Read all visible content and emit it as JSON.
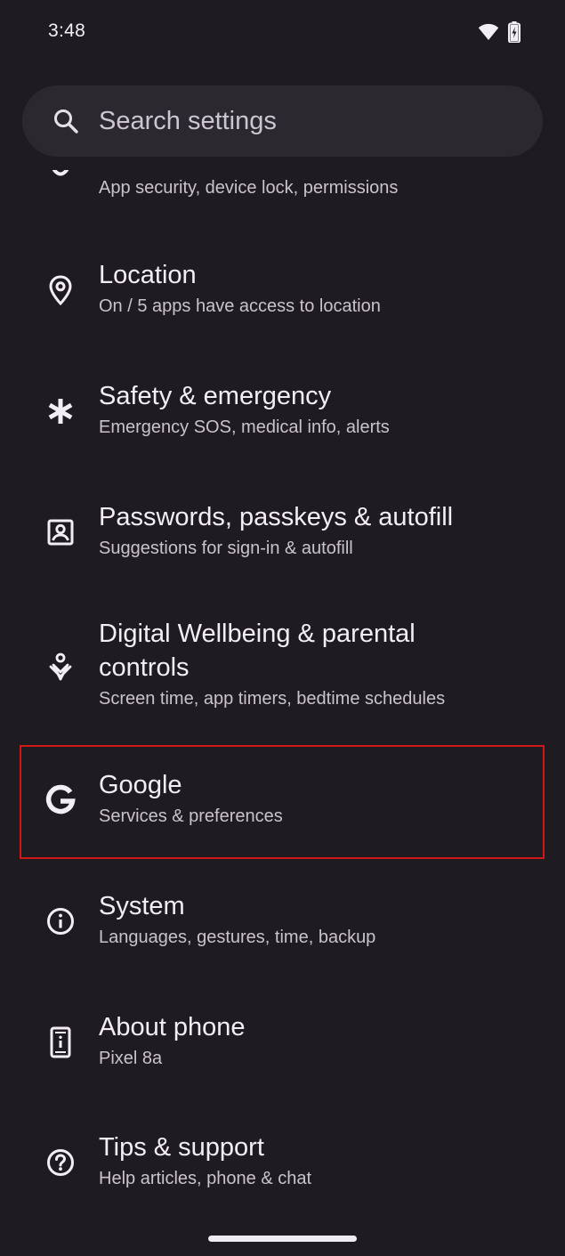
{
  "status_bar": {
    "time": "3:48",
    "icons": [
      "wifi-icon",
      "battery-charging-icon"
    ]
  },
  "search": {
    "placeholder": "Search settings",
    "icon": "search-icon"
  },
  "partial_item": {
    "subtitle": "App security, device lock, permissions",
    "icon": "security-icon"
  },
  "items": [
    {
      "title": "Location",
      "subtitle": "On / 5 apps have access to location",
      "icon": "location-pin-icon"
    },
    {
      "title": "Safety & emergency",
      "subtitle": "Emergency SOS, medical info, alerts",
      "icon": "asterisk-icon"
    },
    {
      "title": "Passwords, passkeys & autofill",
      "subtitle": "Suggestions for sign-in & autofill",
      "icon": "account-box-icon"
    },
    {
      "title_line1": "Digital Wellbeing & parental",
      "title_line2": "controls",
      "subtitle": "Screen time, app timers, bedtime schedules",
      "icon": "wellbeing-icon"
    },
    {
      "title": "Google",
      "subtitle": "Services & preferences",
      "icon": "google-g-icon"
    },
    {
      "title": "System",
      "subtitle": "Languages, gestures, time, backup",
      "icon": "info-icon"
    },
    {
      "title": "About phone",
      "subtitle": "Pixel 8a",
      "icon": "phone-info-icon"
    },
    {
      "title": "Tips & support",
      "subtitle": "Help articles, phone & chat",
      "icon": "help-icon"
    }
  ],
  "colors": {
    "background": "#1f1c21",
    "search_bg": "#2b2830",
    "highlight": "#d01818",
    "title_text": "#f3eef6",
    "subtitle_text": "#c9c3cc"
  }
}
